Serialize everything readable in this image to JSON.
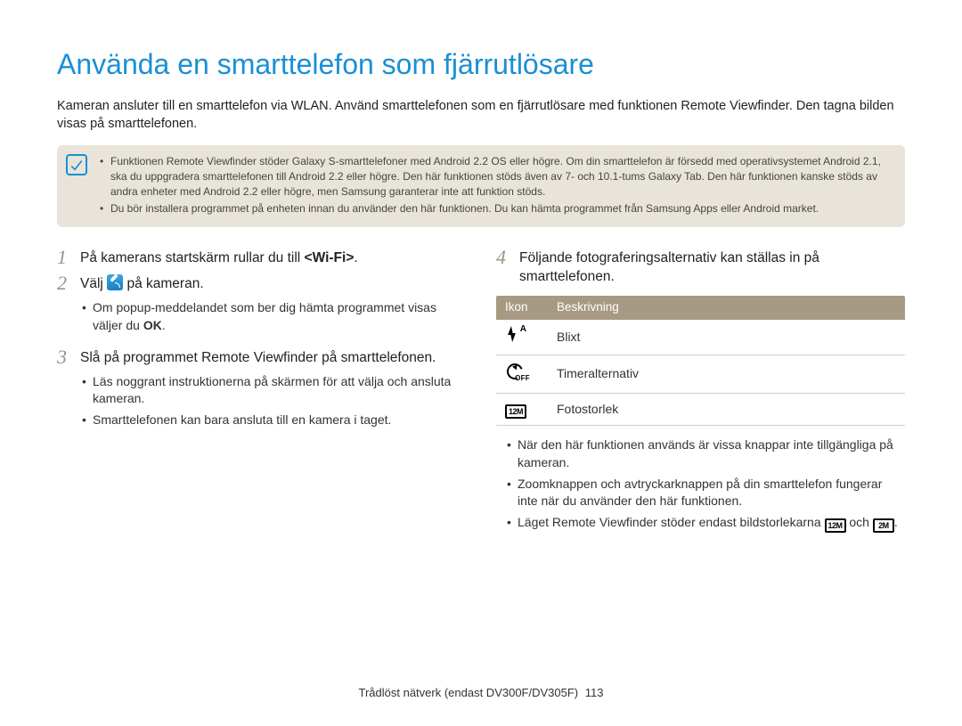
{
  "title": "Använda en smarttelefon som fjärrutlösare",
  "intro": "Kameran ansluter till en smarttelefon via WLAN. Använd smarttelefonen som en fjärrutlösare med funktionen Remote Viewfinder. Den tagna bilden visas på smarttelefonen.",
  "notes": [
    "Funktionen Remote Viewfinder stöder Galaxy S-smarttelefoner med Android 2.2 OS eller högre. Om din smarttelefon är försedd med operativsystemet Android 2.1, ska du uppgradera smarttelefonen till Android 2.2 eller högre. Den här funktionen stöds även av 7- och 10.1-tums Galaxy Tab. Den här funktionen kanske stöds av andra enheter med Android 2.2 eller högre, men Samsung garanterar inte att funktion stöds.",
    "Du bör installera programmet på enheten innan du använder den här funktionen. Du kan hämta programmet från Samsung Apps eller Android market."
  ],
  "left": {
    "step1_pre": "På kamerans startskärm rullar du till ",
    "step1_wifi": "<Wi-Fi>",
    "step1_post": ".",
    "step2_pre": "Välj ",
    "step2_post": " på kameran.",
    "step2_sub_pre": "Om popup-meddelandet som ber dig hämta programmet visas väljer du ",
    "step2_sub_bold": "OK",
    "step2_sub_post": ".",
    "step3": "Slå på programmet Remote Viewfinder på smarttelefonen.",
    "step3_subs": [
      "Läs noggrant instruktionerna på skärmen för att välja och ansluta kameran.",
      "Smarttelefonen kan bara ansluta till en kamera i taget."
    ]
  },
  "right": {
    "step4": "Följande fotograferingsalternativ kan ställas in på smarttelefonen.",
    "table": {
      "headers": [
        "Ikon",
        "Beskrivning"
      ],
      "rows": [
        {
          "icon": "flash",
          "icon_sup": "A",
          "desc": "Blixt"
        },
        {
          "icon": "timer",
          "icon_off": "OFF",
          "desc": "Timeralternativ"
        },
        {
          "icon": "size",
          "icon_text": "12M",
          "desc": "Fotostorlek"
        }
      ]
    },
    "after_bullets": {
      "b1": "När den här funktionen används är vissa knappar inte tillgängliga på kameran.",
      "b2": "Zoomknappen och avtryckarknappen på din smarttelefon fungerar inte när du använder den här funktionen.",
      "b3_pre": "Läget Remote Viewfinder stöder endast bildstorlekarna ",
      "b3_mid": " och ",
      "b3_post": ".",
      "size1": "12M",
      "size2": "2M"
    }
  },
  "footer": {
    "text": "Trådlöst nätverk (endast DV300F/DV305F)",
    "page": "113"
  }
}
